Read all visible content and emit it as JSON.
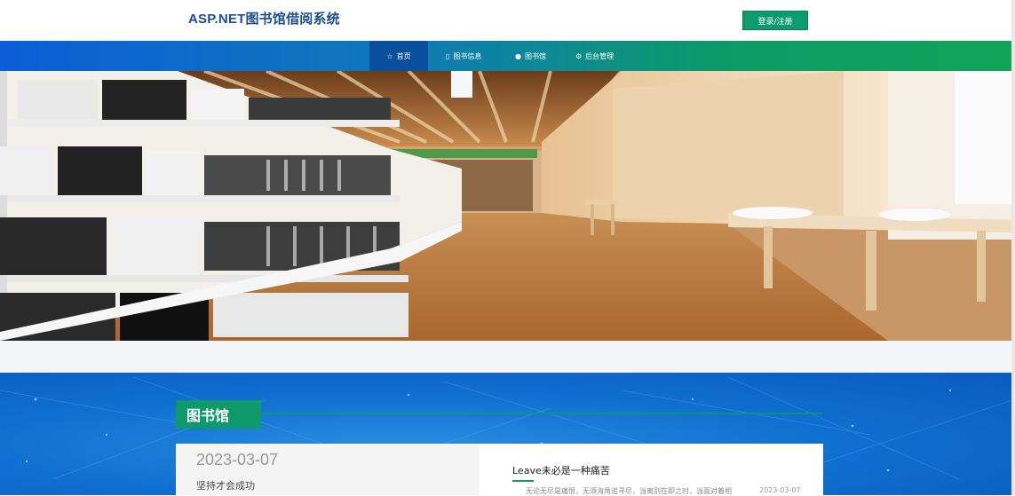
{
  "header": {
    "title": "ASP.NET图书馆借阅系统",
    "login_label": "登录/注册"
  },
  "nav": {
    "items": [
      {
        "label": "首页",
        "icon": "home-icon"
      },
      {
        "label": "图书信息",
        "icon": "book-icon"
      },
      {
        "label": "图书馆",
        "icon": "info-icon"
      },
      {
        "label": "后台管理",
        "icon": "gear-icon"
      }
    ]
  },
  "banner": {
    "slide_count": 3,
    "active_slide": 1
  },
  "library": {
    "section_title": "图书馆",
    "card_date": "2023-03-07",
    "card_subtitle": "坚持才会成功",
    "news_title": "Leave未必是一种痛苦",
    "news_excerpt": "无论无尽是痛恨，无须海角追寻尽，当离别在即之时，当面对着相",
    "news_date": "2023-03-07"
  },
  "colors": {
    "brand_blue": "#1f4d8c",
    "accent_green": "#0e9a6a",
    "nav_active": "#0a4f9e"
  }
}
